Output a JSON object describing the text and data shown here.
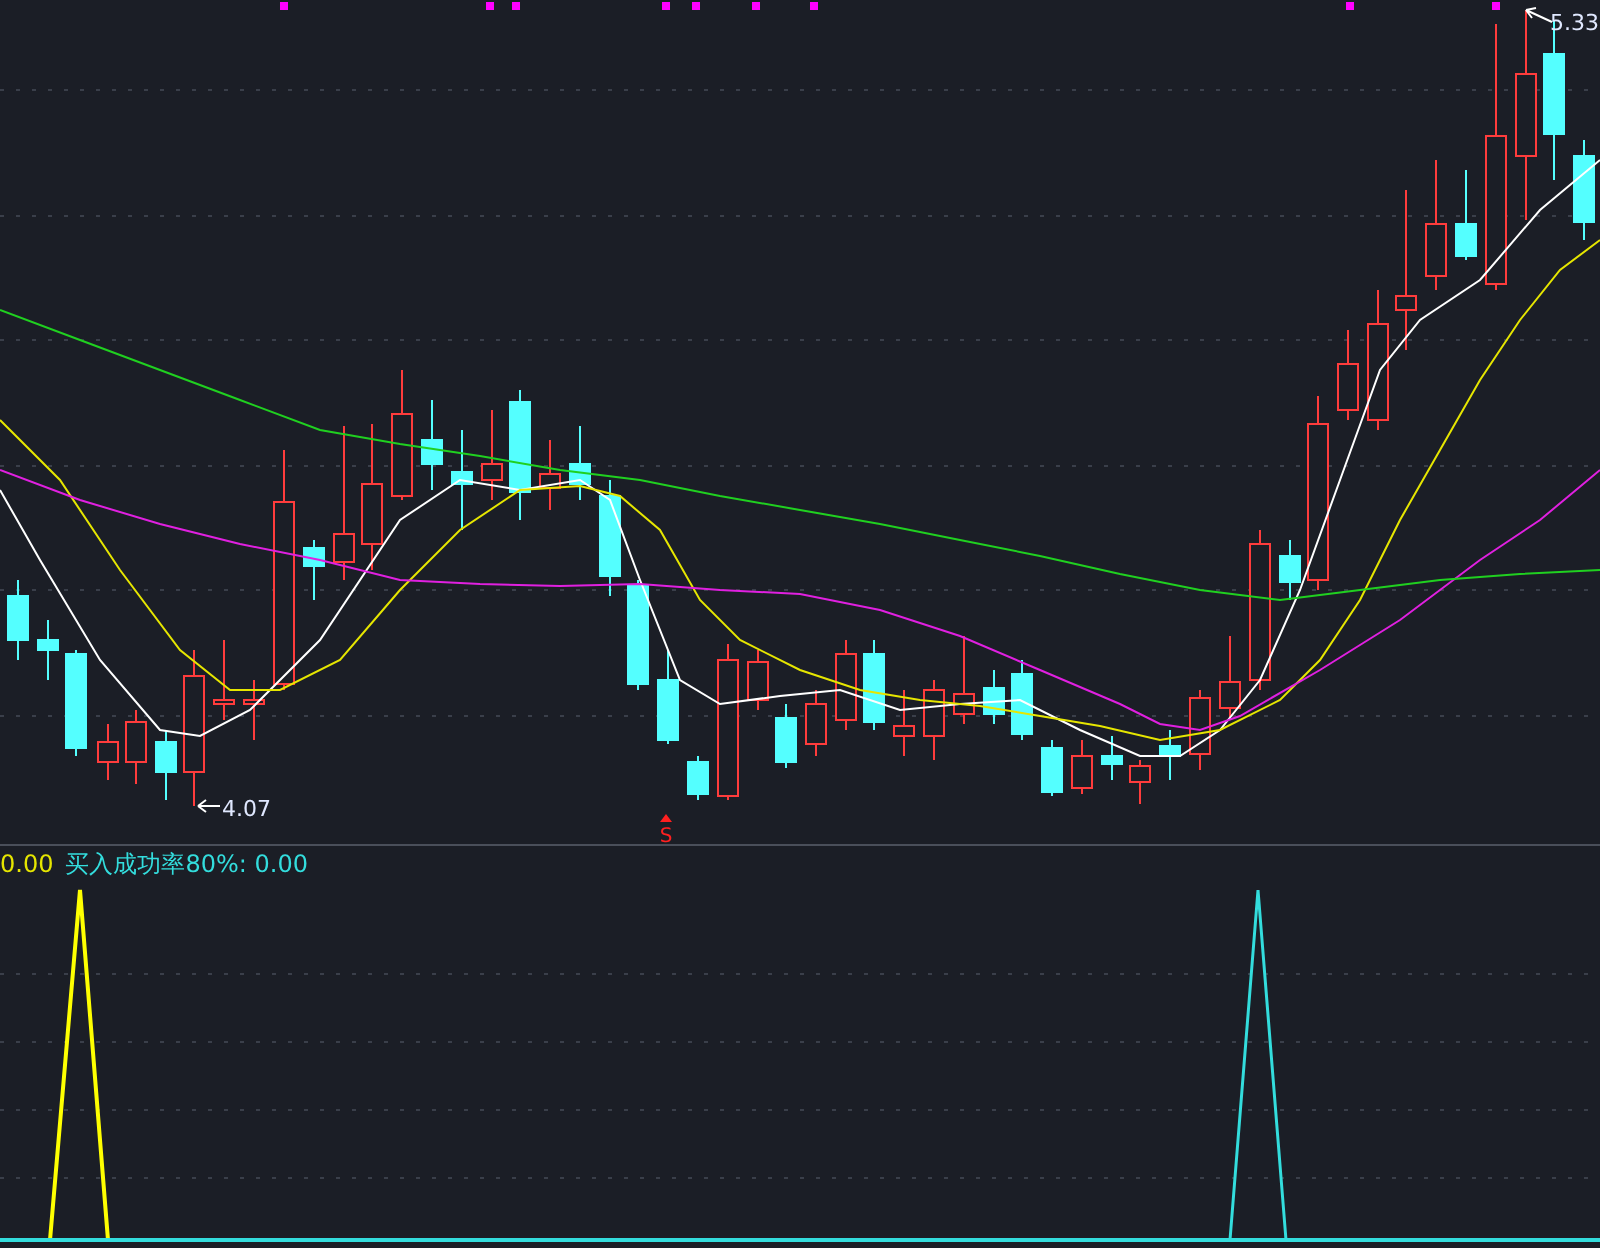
{
  "price_chart": {
    "low_label": "4.07",
    "high_label": "5.33",
    "signal_marker": "S"
  },
  "indicator": {
    "legend": [
      {
        "text": "0.00",
        "color": "#e6e600"
      },
      {
        "text": "买入成功率80%: 0.00",
        "color": "#33dddd"
      }
    ]
  }
}
